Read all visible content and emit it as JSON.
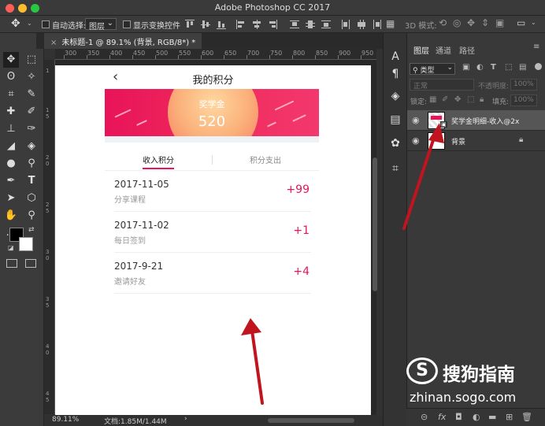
{
  "window": {
    "title": "Adobe Photoshop CC 2017"
  },
  "options_bar": {
    "auto_select_label": "自动选择:",
    "auto_select_value": "图层",
    "show_transform_label": "显示变换控件",
    "mode_3d_label": "3D 模式:"
  },
  "document": {
    "tab_label": "未标题-1 @ 89.1% (背景, RGB/8*) *"
  },
  "ruler": {
    "ticks": [
      "300",
      "350",
      "400",
      "450",
      "500",
      "550",
      "600",
      "650",
      "700",
      "750",
      "800",
      "850",
      "900",
      "950"
    ]
  },
  "status": {
    "zoom": "89.11%",
    "doc_info": "文档:1.85M/1.44M"
  },
  "layers_panel": {
    "tabs": [
      "图层",
      "通道",
      "路径"
    ],
    "filter_kind": "类型",
    "blend_mode": "正常",
    "opacity_label": "不透明度:",
    "opacity_value": "100%",
    "lock_label": "锁定:",
    "fill_label": "填充:",
    "fill_value": "100%",
    "layers": [
      {
        "name": "奖学金明细-收入@2x"
      },
      {
        "name": "背景"
      }
    ],
    "bottom_icons": [
      "link-icon",
      "fx-icon",
      "mask-icon",
      "adjustment-icon",
      "folder-icon",
      "new-layer-icon",
      "trash-icon"
    ]
  },
  "app": {
    "title": "我的积分",
    "back_glyph": "‹",
    "banner_label": "奖学金",
    "banner_value": "520",
    "tabs": [
      "收入积分",
      "积分支出"
    ],
    "records": [
      {
        "date": "2017-11-05",
        "desc": "分享课程",
        "points": "+99"
      },
      {
        "date": "2017-11-02",
        "desc": "每日签到",
        "points": "+1"
      },
      {
        "date": "2017-9-21",
        "desc": "邀请好友",
        "points": "+4"
      }
    ]
  },
  "watermark": {
    "logo_glyph": "S",
    "title": "搜狗指南",
    "url": "zhinan.sogo.com"
  },
  "colors": {
    "accent": "#e8145a",
    "arrow": "#c0151e"
  }
}
